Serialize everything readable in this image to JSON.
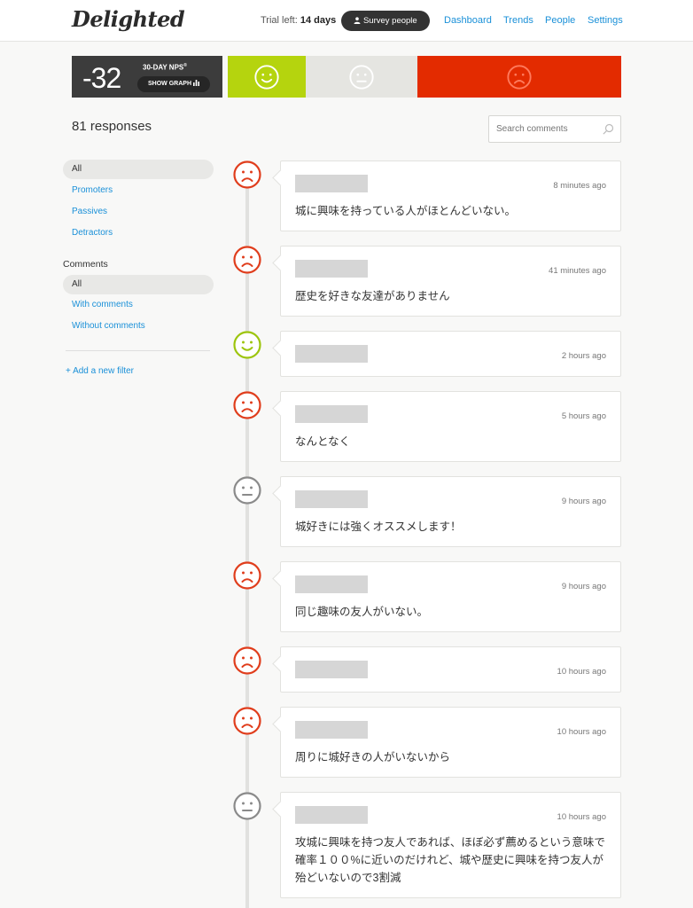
{
  "header": {
    "logo": "Delighted",
    "trial_label": "Trial left:",
    "trial_days": "14 days",
    "survey_button": "Survey people",
    "nav": [
      "Dashboard",
      "Trends",
      "People",
      "Settings"
    ]
  },
  "nps": {
    "score": "-32",
    "label": "30-DAY NPS",
    "label_mark": "®",
    "show_graph": "SHOW GRAPH"
  },
  "colors": {
    "promoter": "#b5d40e",
    "passive": "#e5e5e1",
    "detractor": "#e32b00",
    "link": "#1a90d8"
  },
  "responses_count": "81 responses",
  "search": {
    "placeholder": "Search comments"
  },
  "filters": {
    "type": [
      "All",
      "Promoters",
      "Passives",
      "Detractors"
    ],
    "comments_heading": "Comments",
    "comments": [
      "All",
      "With comments",
      "Without comments"
    ],
    "add_filter": "+ Add a new filter"
  },
  "responses": [
    {
      "type": "detractor",
      "time": "8 minutes ago",
      "comment": "城に興味を持っている人がほとんどいない。"
    },
    {
      "type": "detractor",
      "time": "41 minutes ago",
      "comment": "歴史を好きな友達がありません"
    },
    {
      "type": "promoter",
      "time": "2 hours ago",
      "comment": ""
    },
    {
      "type": "detractor",
      "time": "5 hours ago",
      "comment": "なんとなく"
    },
    {
      "type": "passive",
      "time": "9 hours ago",
      "comment": "城好きには強くオススメします！"
    },
    {
      "type": "detractor",
      "time": "9 hours ago",
      "comment": "同じ趣味の友人がいない。"
    },
    {
      "type": "detractor",
      "time": "10 hours ago",
      "comment": ""
    },
    {
      "type": "detractor",
      "time": "10 hours ago",
      "comment": "周りに城好きの人がいないから"
    },
    {
      "type": "passive",
      "time": "10 hours ago",
      "comment": "攻城に興味を持つ友人であれば、ほぼ必ず薦めるという意味で確率１００%に近いのだけれど、城や歴史に興味を持つ友人が殆どいないので3割減"
    }
  ]
}
